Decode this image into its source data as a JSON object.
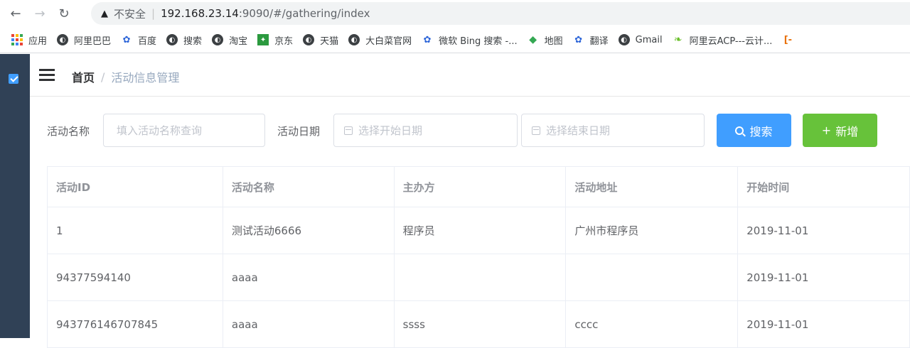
{
  "browser": {
    "insecure_label": "不安全",
    "url_host": "192.168.23.14",
    "url_rest": ":9090/#/gathering/index",
    "bookmarks": [
      {
        "label": "应用",
        "icon": "apps-grid-icon"
      },
      {
        "label": "阿里巴巴",
        "icon": "globe-icon"
      },
      {
        "label": "百度",
        "icon": "baidu-paw-icon"
      },
      {
        "label": "搜索",
        "icon": "globe-icon"
      },
      {
        "label": "淘宝",
        "icon": "globe-icon"
      },
      {
        "label": "京东",
        "icon": "jd-icon"
      },
      {
        "label": "天猫",
        "icon": "globe-icon"
      },
      {
        "label": "大白菜官网",
        "icon": "globe-icon"
      },
      {
        "label": "微软 Bing 搜索 -...",
        "icon": "baidu-paw-icon"
      },
      {
        "label": "地图",
        "icon": "map-icon"
      },
      {
        "label": "翻译",
        "icon": "baidu-paw-icon"
      },
      {
        "label": "Gmail",
        "icon": "globe-icon"
      },
      {
        "label": "阿里云ACP---云计...",
        "icon": "aliyun-leaf-icon"
      }
    ]
  },
  "breadcrumb": {
    "home": "首页",
    "separator": "/",
    "current": "活动信息管理"
  },
  "filter": {
    "name_label": "活动名称",
    "name_placeholder": "填入活动名称查询",
    "date_label": "活动日期",
    "start_placeholder": "选择开始日期",
    "end_placeholder": "选择结束日期",
    "search_label": "搜索",
    "add_label": "新增"
  },
  "table": {
    "columns": [
      "活动ID",
      "活动名称",
      "主办方",
      "活动地址",
      "开始时间"
    ],
    "rows": [
      [
        "1",
        "测试活动6666",
        "程序员",
        "广州市程序员",
        "2019-11-01"
      ],
      [
        "94377594140",
        "aaaa",
        "",
        "",
        "2019-11-01"
      ],
      [
        "943776146707845",
        "aaaa",
        "ssss",
        "cccc",
        "2019-11-01"
      ]
    ]
  },
  "colors": {
    "sidebar": "#304156",
    "primary": "#409eff",
    "success": "#67c23a"
  }
}
